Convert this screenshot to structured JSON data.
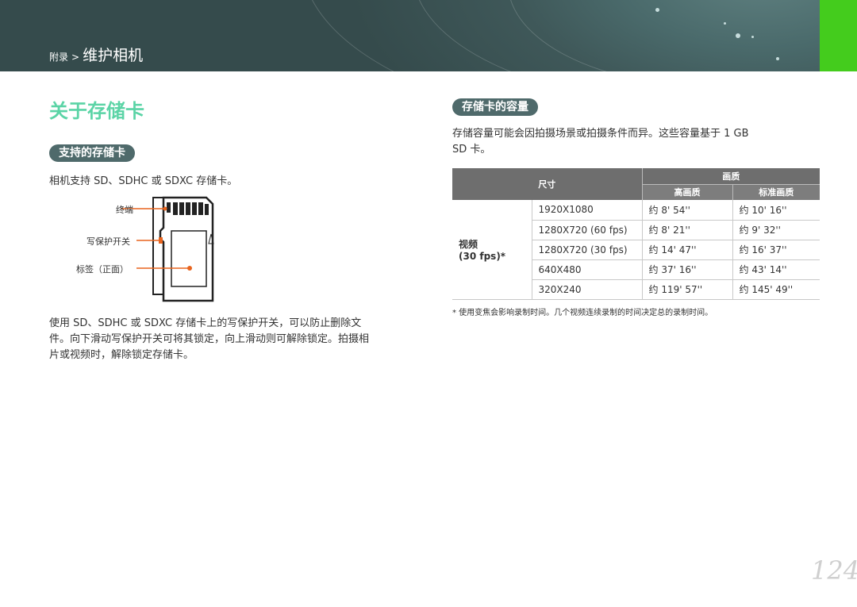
{
  "header": {
    "breadcrumb_parent": "附录",
    "breadcrumb_separator": ">",
    "breadcrumb_current": "维护相机",
    "accent_color": "#44cc1d"
  },
  "page_title": "关于存储卡",
  "left": {
    "section_title": "支持的存储卡",
    "supported_text": "相机支持 SD、SDHC 或 SDXC 存储卡。",
    "figure_labels": {
      "terminal": "终端",
      "write_protect": "写保护开关",
      "label_front": "标签（正面）"
    },
    "lock_paragraph_lines": [
      "使用 SD、SDHC 或 SDXC 存储卡上的写保护开关，可以防止删除文",
      "件。向下滑动写保护开关可将其锁定，向上滑动则可解除锁定。拍摄相",
      "片或视频时，解除锁定存储卡。"
    ]
  },
  "right": {
    "section_title": "存储卡的容量",
    "intro_lines": [
      "存储容量可能会因拍摄场景或拍摄条件而异。这些容量基于 1 GB",
      "SD 卡。"
    ],
    "table": {
      "size_header": "尺寸",
      "quality_header": "画质",
      "quality_high": "高画质",
      "quality_standard": "标准画质",
      "video_label_line1": "视频",
      "video_label_line2": "(30 fps)*",
      "rows": [
        {
          "resolution": "1920X1080",
          "high": "约 8' 54''",
          "standard": "约 10' 16''"
        },
        {
          "resolution": "1280X720 (60 fps)",
          "high": "约 8' 21''",
          "standard": "约 9' 32''"
        },
        {
          "resolution": "1280X720 (30 fps)",
          "high": "约 14' 47''",
          "standard": "约 16' 37''"
        },
        {
          "resolution": "640X480",
          "high": "约 37' 16''",
          "standard": "约 43' 14''"
        },
        {
          "resolution": "320X240",
          "high": "约 119' 57''",
          "standard": "约 145' 49''"
        }
      ]
    },
    "footnote": "* 使用变焦会影响录制时间。几个视频连续录制的时间决定总的录制时间。"
  },
  "page_number": "124",
  "colors": {
    "title_green": "#5bd4a6",
    "pill_bg": "#4f6a6b",
    "label_line_orange": "#e8641e"
  }
}
